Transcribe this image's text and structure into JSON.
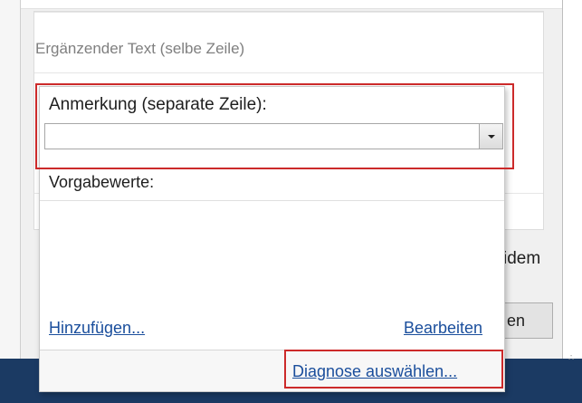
{
  "background": {
    "supplementary_text": "Ergänzender Text (selbe Zeile)",
    "side_label": "idem",
    "side_button_label": "en"
  },
  "popup": {
    "annotation_label": "Anmerkung (separate Zeile):",
    "annotation_value": "",
    "default_values_label": "Vorgabewerte:",
    "default_values": [],
    "add_link": "Hinzufügen...",
    "edit_link": "Bearbeiten",
    "diagnosis_link": "Diagnose auswählen..."
  },
  "icons": {
    "dropdown": "chevron-down-icon",
    "resize_grip": "resize-grip-icon"
  },
  "colors": {
    "highlight": "#cc2a2a",
    "link": "#1a4e9c",
    "taskbar": "#1b3a63"
  }
}
